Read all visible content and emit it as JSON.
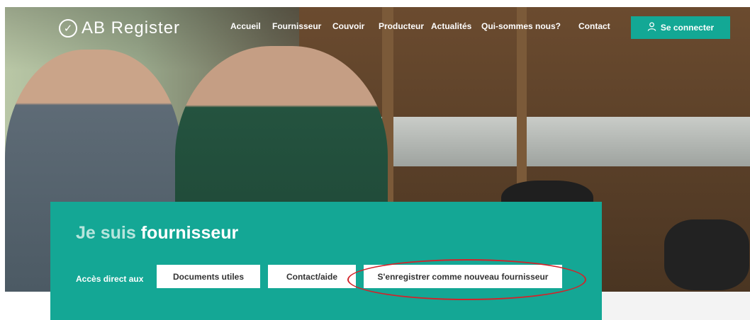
{
  "header": {
    "logo_text": "AB Register",
    "nav": [
      "Accueil",
      "Fournisseur",
      "Couvoir",
      "Producteur",
      "Actualités",
      "Qui-sommes nous?",
      "Contact"
    ],
    "login_label": "Se connecter"
  },
  "panel": {
    "title_light": "Je suis",
    "title_bold": "fournisseur",
    "lead": "Accès direct aux",
    "buttons": [
      "Documents utiles",
      "Contact/aide",
      "S'enregistrer comme nouveau fournisseur"
    ]
  },
  "colors": {
    "accent": "#14a795",
    "highlight": "#d2232a"
  }
}
